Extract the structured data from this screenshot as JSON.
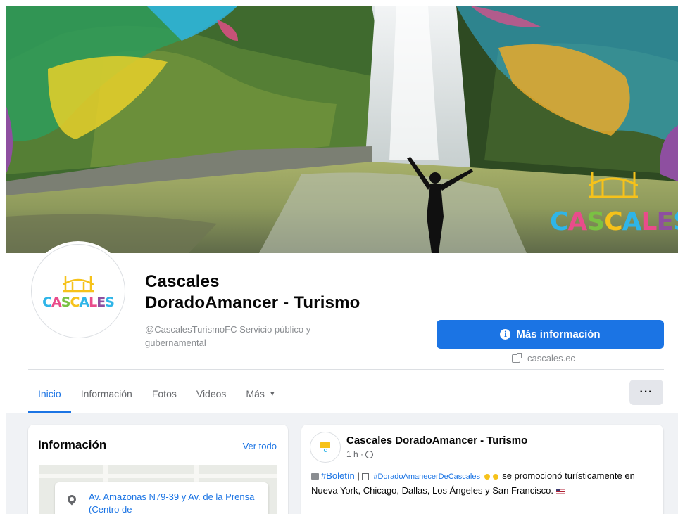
{
  "cover": {
    "logo_letters": [
      "C",
      "A",
      "S",
      "C",
      "A",
      "L",
      "E",
      "S"
    ]
  },
  "profile": {
    "avatar_letters": [
      "C",
      "A",
      "S",
      "C",
      "A",
      "L",
      "E",
      "S"
    ],
    "name_line1": "Cascales",
    "name_line2": "DoradoAmancer - Turismo",
    "subtitle": "@CascalesTurismoFC Servicio público y gubernamental"
  },
  "actions": {
    "more_info_label": "Más información",
    "website": "cascales.ec"
  },
  "tabs": [
    {
      "label": "Inicio",
      "active": true
    },
    {
      "label": "Información"
    },
    {
      "label": "Fotos"
    },
    {
      "label": "Videos"
    },
    {
      "label": "Más"
    }
  ],
  "more_button_label": "···",
  "info_card": {
    "title": "Información",
    "see_all": "Ver todo",
    "address": "Av. Amazonas N79-39 y Av. de la Prensa (Centro de"
  },
  "post": {
    "author": "Cascales DoradoAmancer - Turismo",
    "time": "1 h ·",
    "hashtag": "#Boletín",
    "separator": "|",
    "mention": "#DoradoAmanecerDeCascales",
    "text_main": "se promocionó turísticamente en Nueva York, Chicago, Dallas, Los Ángeles y San Francisco."
  },
  "colors": {
    "accent": "#1b74e4",
    "background": "#f0f2f5",
    "text": "#050505",
    "secondary": "#65676b"
  }
}
